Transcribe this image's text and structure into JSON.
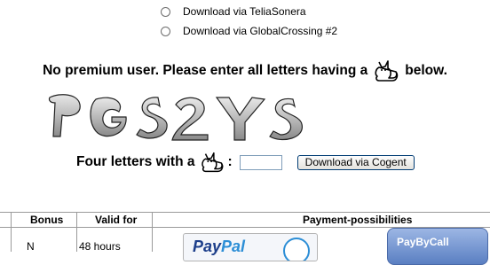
{
  "download_options": [
    {
      "label": "Download via TeliaSonera"
    },
    {
      "label": "Download via GlobalCrossing #2"
    }
  ],
  "captcha": {
    "instruction_before": "No premium user. Please enter all letters having a",
    "instruction_after": "below.",
    "letters": "PGS2YS",
    "prompt": "Four letters with a",
    "colon": ":",
    "input_value": "",
    "button_label": "Download via Cogent"
  },
  "table": {
    "headers": [
      "Bonus",
      "Valid for",
      "Payment-possibilities"
    ],
    "row": {
      "bonus": "N",
      "valid_for": "48 hours"
    }
  },
  "payment": {
    "paypal_pay": "Pay",
    "paypal_pal": "Pal",
    "paybycall": "PayByCall"
  },
  "icons": {
    "cat": "cat-icon"
  }
}
